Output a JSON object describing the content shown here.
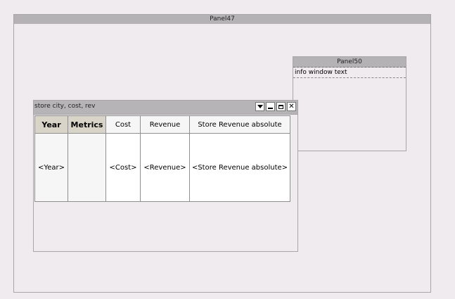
{
  "panel47": {
    "title": "Panel47"
  },
  "panel50": {
    "title": "Panel50",
    "info_text": "info window text"
  },
  "grid_window": {
    "title": "store city, cost, rev",
    "buttons": {
      "menu_icon": "dropdown-icon",
      "minimize_icon": "minimize-icon",
      "maximize_icon": "maximize-icon",
      "close_icon": "close-icon",
      "close_label": "✕"
    },
    "columns": [
      "Year",
      "Metrics",
      "Cost",
      "Revenue",
      "Store Revenue absolute"
    ],
    "row": [
      "<Year>",
      "",
      "<Cost>",
      "<Revenue>",
      "<Store Revenue absolute>"
    ]
  },
  "colors": {
    "background": "#efebef",
    "title_bar": "#b4b2b4",
    "header_cell": "#d8d4c8"
  }
}
